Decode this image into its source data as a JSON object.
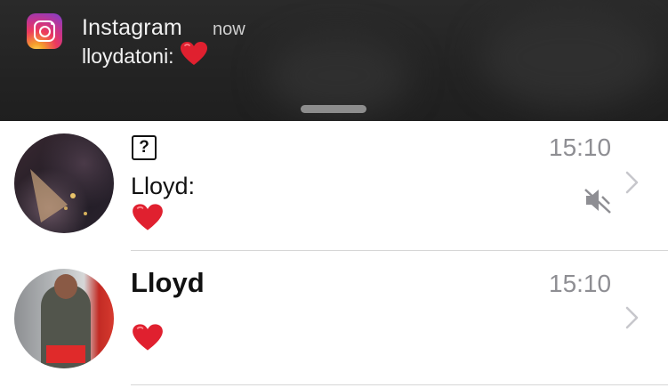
{
  "notification": {
    "app_name": "Instagram",
    "time": "now",
    "sender": "lloydatoni:",
    "message_icon": "red-heart-emoji",
    "app_icon": "instagram-icon"
  },
  "conversations": [
    {
      "header_icon": "unknown-character-box",
      "header_glyph": "?",
      "sender": "Lloyd:",
      "message_icon": "red-heart-emoji",
      "time": "15:10",
      "muted": true,
      "avatar": "photo-avatar"
    },
    {
      "title": "Lloyd",
      "message_icon": "red-heart-emoji",
      "time": "15:10",
      "muted": false,
      "avatar": "photo-avatar"
    }
  ],
  "colors": {
    "banner_bg": "#232323",
    "heart": "#e0202f",
    "secondary_text": "#8e8e93"
  }
}
